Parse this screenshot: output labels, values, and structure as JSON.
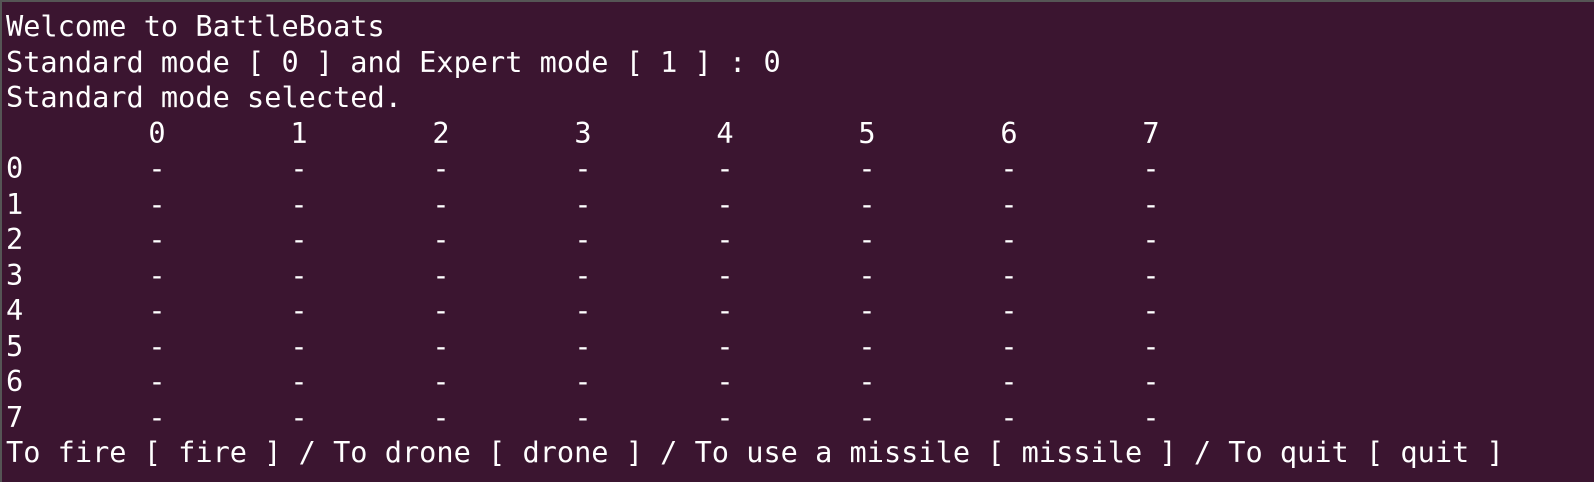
{
  "terminal": {
    "welcome": "Welcome to BattleBoats",
    "mode_prompt": "Standard mode [ 0 ] and Expert mode [ 1 ] : 0",
    "mode_selected": "Standard mode selected.",
    "column_headers": [
      "0",
      "1",
      "2",
      "3",
      "4",
      "5",
      "6",
      "7"
    ],
    "board_rows": [
      {
        "label": "0",
        "cells": [
          "-",
          "-",
          "-",
          "-",
          "-",
          "-",
          "-",
          "-"
        ]
      },
      {
        "label": "1",
        "cells": [
          "-",
          "-",
          "-",
          "-",
          "-",
          "-",
          "-",
          "-"
        ]
      },
      {
        "label": "2",
        "cells": [
          "-",
          "-",
          "-",
          "-",
          "-",
          "-",
          "-",
          "-"
        ]
      },
      {
        "label": "3",
        "cells": [
          "-",
          "-",
          "-",
          "-",
          "-",
          "-",
          "-",
          "-"
        ]
      },
      {
        "label": "4",
        "cells": [
          "-",
          "-",
          "-",
          "-",
          "-",
          "-",
          "-",
          "-"
        ]
      },
      {
        "label": "5",
        "cells": [
          "-",
          "-",
          "-",
          "-",
          "-",
          "-",
          "-",
          "-"
        ]
      },
      {
        "label": "6",
        "cells": [
          "-",
          "-",
          "-",
          "-",
          "-",
          "-",
          "-",
          "-"
        ]
      },
      {
        "label": "7",
        "cells": [
          "-",
          "-",
          "-",
          "-",
          "-",
          "-",
          "-",
          "-"
        ]
      }
    ],
    "command_prompt": "To fire [ fire ] / To drone [ drone ] / To use a missile [ missile ] / To quit [ quit ]",
    "colors": {
      "background": "#3b1530",
      "foreground": "#ffffff"
    }
  }
}
